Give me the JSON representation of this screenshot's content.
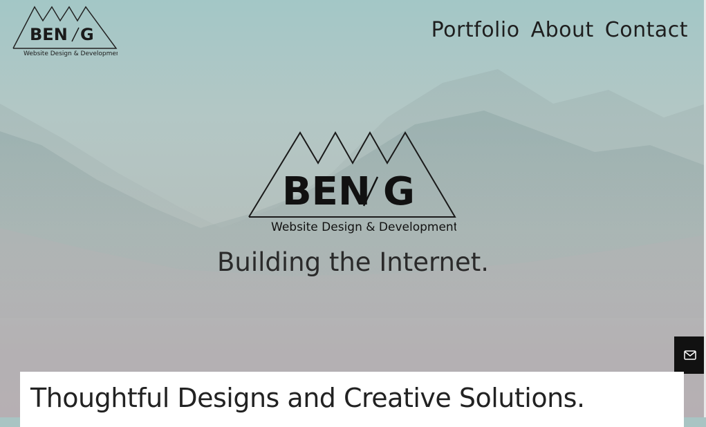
{
  "brand": {
    "name_left": "BEN",
    "name_right": "G",
    "tagline_small": "Website Design & Development"
  },
  "nav": {
    "items": [
      {
        "label": "Portfolio"
      },
      {
        "label": "About"
      },
      {
        "label": "Contact"
      }
    ]
  },
  "hero": {
    "headline": "Building the Internet."
  },
  "section": {
    "title": "Thoughtful Designs and Creative Solutions."
  },
  "icons": {
    "contact_float": "envelope-icon"
  }
}
